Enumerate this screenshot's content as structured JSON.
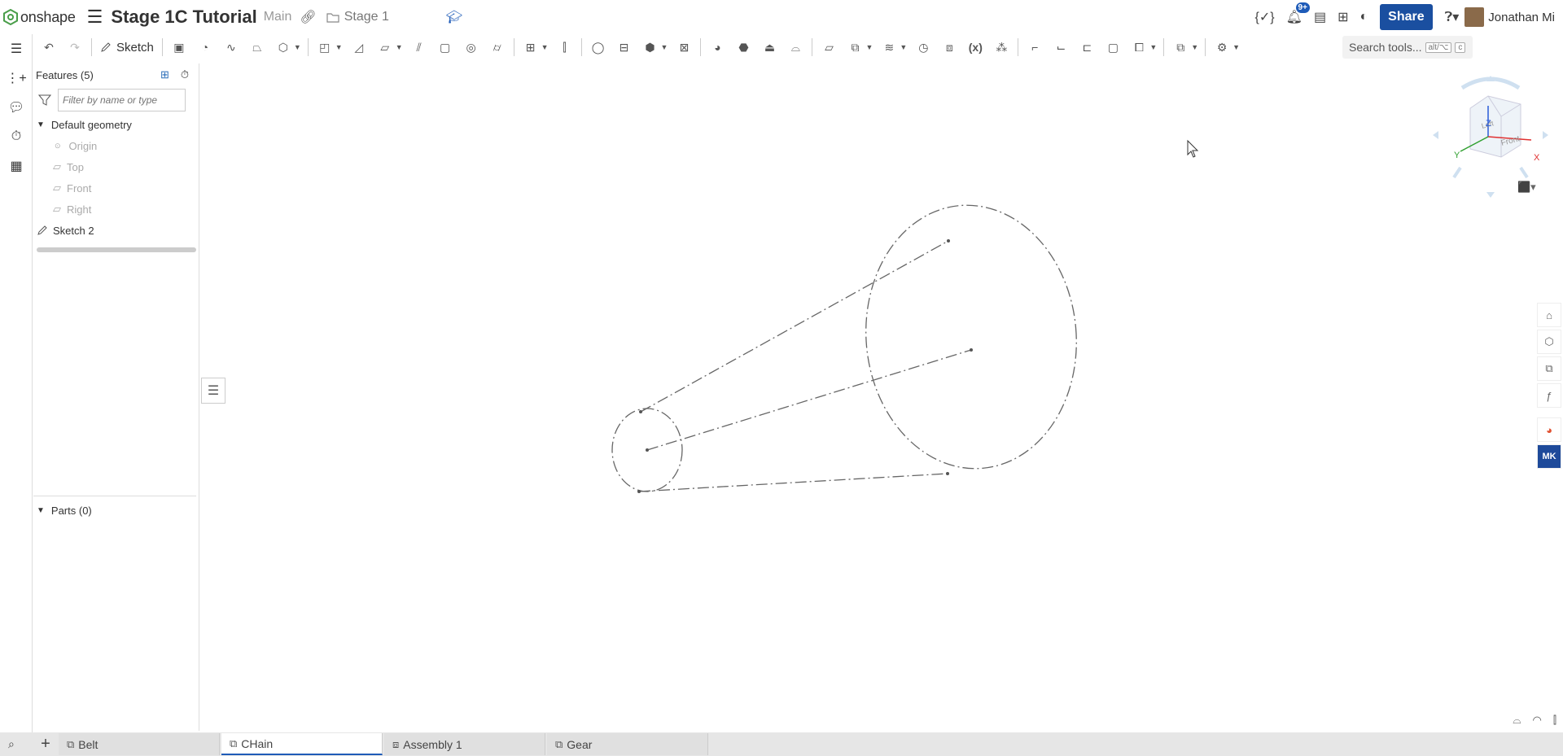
{
  "app": {
    "logo_text": "onshape"
  },
  "header": {
    "doc_title": "Stage 1C Tutorial",
    "branch": "Main",
    "folder": "Stage 1",
    "notification_count": "9+",
    "share_label": "Share",
    "user_name": "Jonathan Mi"
  },
  "toolbar": {
    "sketch_label": "Sketch",
    "search_placeholder": "Search tools...",
    "search_shortcut_1": "alt/⌥",
    "search_shortcut_2": "c"
  },
  "features": {
    "title": "Features (5)",
    "filter_placeholder": "Filter by name or type",
    "default_geometry": "Default geometry",
    "items": [
      "Origin",
      "Top",
      "Front",
      "Right"
    ],
    "sketch": "Sketch 2",
    "parts_title": "Parts (0)"
  },
  "viewcube": {
    "top": "Z",
    "front": "Front",
    "left": "Left",
    "x": "X",
    "y": "Y"
  },
  "tabs": [
    {
      "label": "Belt"
    },
    {
      "label": "CHain"
    },
    {
      "label": "Assembly 1"
    },
    {
      "label": "Gear"
    }
  ],
  "colors": {
    "accent": "#1e5bb8",
    "share": "#1a4fa0",
    "sketch_line": "#666666"
  }
}
